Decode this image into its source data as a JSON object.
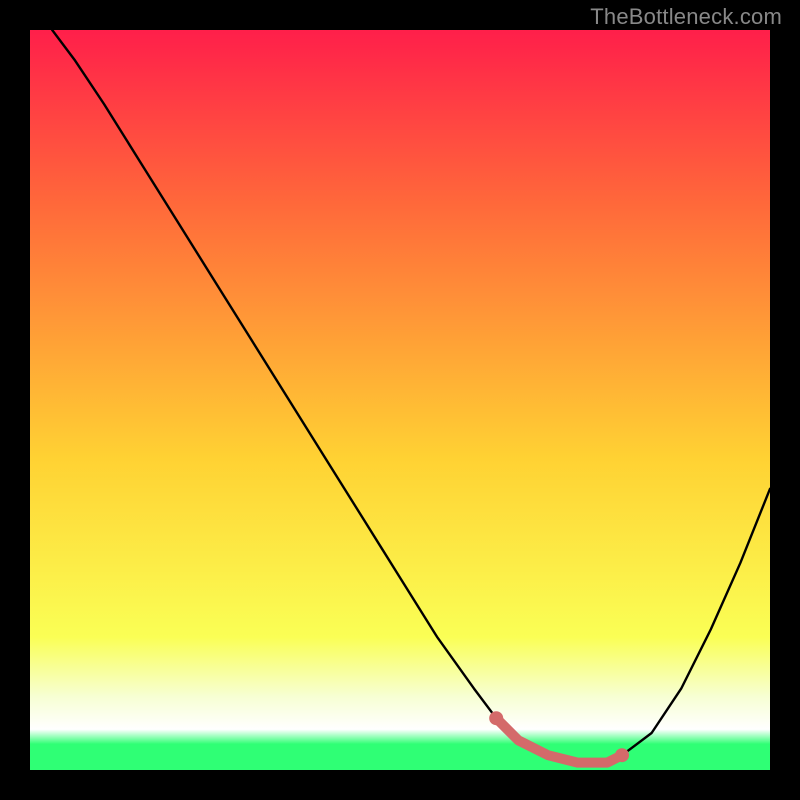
{
  "watermark": "TheBottleneck.com",
  "colors": {
    "top": "#ff1f4a",
    "midUpper": "#ff6a3a",
    "mid": "#ffd233",
    "lowerYellow": "#faff55",
    "paleBand": "#f7ffd2",
    "bottom": "#2fff75",
    "curve": "#000000",
    "marker": "#d46a6a",
    "markerStroke": "#d46a6a"
  },
  "chart_data": {
    "type": "line",
    "title": "",
    "xlabel": "",
    "ylabel": "",
    "xlim": [
      0,
      100
    ],
    "ylim": [
      0,
      100
    ],
    "x": [
      3,
      6,
      10,
      15,
      20,
      25,
      30,
      35,
      40,
      45,
      50,
      55,
      60,
      63,
      66,
      70,
      74,
      78,
      80,
      84,
      88,
      92,
      96,
      100
    ],
    "values": [
      100,
      96,
      90,
      82,
      74,
      66,
      58,
      50,
      42,
      34,
      26,
      18,
      11,
      7,
      4,
      2,
      1,
      1,
      2,
      5,
      11,
      19,
      28,
      38
    ],
    "highlight_segment": {
      "x": [
        63,
        66,
        70,
        74,
        78,
        80
      ],
      "values": [
        7,
        4,
        2,
        1,
        1,
        2
      ]
    },
    "highlight_points": [
      {
        "x": 63,
        "y": 7
      },
      {
        "x": 80,
        "y": 2
      }
    ]
  }
}
